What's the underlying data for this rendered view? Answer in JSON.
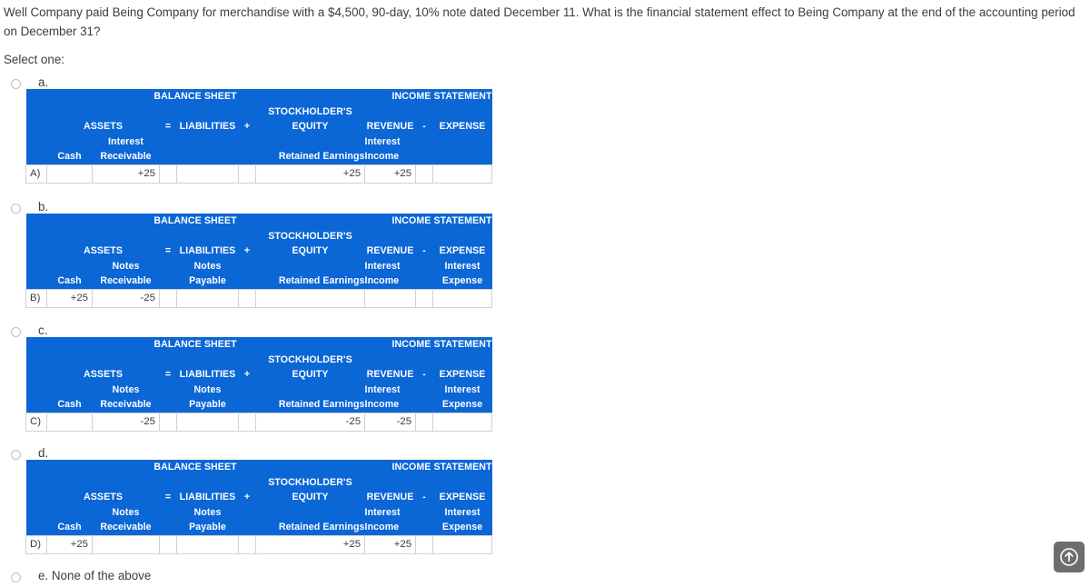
{
  "question": {
    "text": "Well Company paid Being Company for merchandise with a $4,500, 90-day, 10% note dated December 11. What is the financial statement effect to Being Company at the end of the accounting period on December 31?",
    "select_prompt": "Select one:"
  },
  "colors": {
    "header_blue": "#0b66d6",
    "header_text": "#ffffff",
    "body_text": "#3d3d3d",
    "cell_border": "#d2d2d2",
    "scroll_button": "#6d6d6d"
  },
  "table_headers": {
    "balance_sheet": "BALANCE SHEET",
    "income_statement": "INCOME STATEMENT",
    "stockholders": "STOCKHOLDER'S",
    "assets": "ASSETS",
    "equals": "=",
    "liabilities": "LIABILITIES",
    "plus": "+",
    "equity": "EQUITY",
    "revenue": "REVENUE",
    "minus": "-",
    "expense": "EXPENSE",
    "cash": "Cash",
    "retained_earnings": "Retained Earnings"
  },
  "options": [
    {
      "letter": "a.",
      "row_label": "A)",
      "sub_headers": {
        "receivable_line1": "Interest",
        "receivable_line2": "Receivable",
        "payable_line1": "",
        "payable_line2": "",
        "revenue_line1": "Interest",
        "revenue_line2": "Income",
        "expense_line1": "",
        "expense_line2": ""
      },
      "values": {
        "cash": "",
        "receivable": "+25",
        "payable": "",
        "retained_earnings": "+25",
        "revenue": "+25",
        "expense": ""
      }
    },
    {
      "letter": "b.",
      "row_label": "B)",
      "sub_headers": {
        "receivable_line1": "Notes",
        "receivable_line2": "Receivable",
        "payable_line1": "Notes",
        "payable_line2": "Payable",
        "revenue_line1": "Interest",
        "revenue_line2": "Income",
        "expense_line1": "Interest",
        "expense_line2": "Expense"
      },
      "values": {
        "cash": "+25",
        "receivable": "-25",
        "payable": "",
        "retained_earnings": "",
        "revenue": "",
        "expense": ""
      }
    },
    {
      "letter": "c.",
      "row_label": "C)",
      "sub_headers": {
        "receivable_line1": "Notes",
        "receivable_line2": "Receivable",
        "payable_line1": "Notes",
        "payable_line2": "Payable",
        "revenue_line1": "Interest",
        "revenue_line2": "Income",
        "expense_line1": "Interest",
        "expense_line2": "Expense"
      },
      "values": {
        "cash": "",
        "receivable": "-25",
        "payable": "",
        "retained_earnings": "-25",
        "revenue": "-25",
        "expense": ""
      }
    },
    {
      "letter": "d.",
      "row_label": "D)",
      "sub_headers": {
        "receivable_line1": "Notes",
        "receivable_line2": "Receivable",
        "payable_line1": "Notes",
        "payable_line2": "Payable",
        "revenue_line1": "Interest",
        "revenue_line2": "Income",
        "expense_line1": "Interest",
        "expense_line2": "Expense"
      },
      "values": {
        "cash": "+25",
        "receivable": "",
        "payable": "",
        "retained_earnings": "+25",
        "revenue": "+25",
        "expense": ""
      }
    }
  ],
  "option_e": {
    "label": "e. None of the above"
  },
  "scroll_top_button": {
    "icon": "arrow-up-circle-icon"
  }
}
